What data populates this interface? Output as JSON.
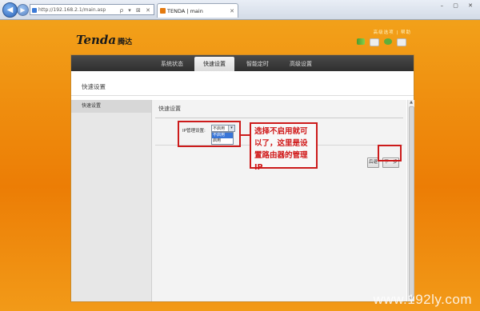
{
  "browser": {
    "address": "http://192.168.2.1/main.asp",
    "address_icons": "ρ ▾ ⊠ ✕",
    "tab_title": "TENDA | main",
    "tab_close": "✕",
    "back_glyph": "◀",
    "forward_glyph": "▶",
    "window_controls": "– ▢ ✕"
  },
  "header": {
    "logo_text": "Tenda",
    "logo_cn": "腾达",
    "top_links": "高级选项 | 帮助"
  },
  "menu": {
    "tabs": [
      "系统状态",
      "快速设置",
      "智能定时",
      "高级设置"
    ],
    "active_index": 1
  },
  "page": {
    "title": "快速设置"
  },
  "sidebar": {
    "items": [
      {
        "label": "快速设置"
      }
    ]
  },
  "content": {
    "title": "快速设置",
    "ip_label": "IP管理设置:",
    "ip_select_value": "不启用",
    "ip_select_arrow": "▾",
    "dropdown_options": [
      "不启用",
      "启用"
    ],
    "back_label": "后退",
    "next_label": "下一步"
  },
  "annotation": {
    "note_text": "选择不启用就可以了，这里是设置路由器的管理IP"
  },
  "watermark": "www.192ly.com",
  "colors": {
    "annotation_red": "#cc1b1b",
    "background_orange": "#ef8d0e",
    "menu_dark": "#3a3a3a",
    "selected_option": "#3875d7"
  }
}
